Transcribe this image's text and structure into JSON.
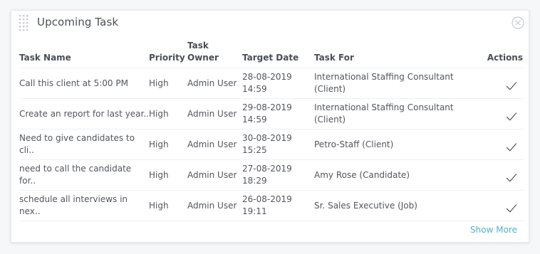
{
  "widget": {
    "title": "Upcoming Task",
    "show_more_label": "Show More",
    "icons": {
      "drag_handle": "drag-handle-icon",
      "close": "close-icon",
      "action": "checkmark-icon"
    },
    "colors": {
      "accent_link": "#4fb3cc",
      "text": "#52565d"
    }
  },
  "table": {
    "headers": {
      "task_name": "Task Name",
      "priority": "Priority",
      "task_owner": "Task Owner",
      "target_date": "Target Date",
      "task_for": "Task For",
      "actions": "Actions"
    },
    "rows": [
      {
        "task_name": "Call this client at 5:00 PM",
        "priority": "High",
        "task_owner": "Admin User",
        "target_date": "28-08-2019 14:59",
        "task_for": "International Staffing Consultant (Client)"
      },
      {
        "task_name": "Create an report for last year..",
        "priority": "High",
        "task_owner": "Admin User",
        "target_date": "29-08-2019 14:59",
        "task_for": "International Staffing Consultant (Client)"
      },
      {
        "task_name": "Need to give candidates to cli..",
        "priority": "High",
        "task_owner": "Admin User",
        "target_date": "30-08-2019 15:25",
        "task_for": "Petro-Staff (Client)"
      },
      {
        "task_name": "need to call the candidate for..",
        "priority": "High",
        "task_owner": "Admin User",
        "target_date": "27-08-2019 18:29",
        "task_for": "Amy Rose (Candidate)"
      },
      {
        "task_name": "schedule all interviews in nex..",
        "priority": "High",
        "task_owner": "Admin User",
        "target_date": "26-08-2019 19:11",
        "task_for": "Sr. Sales Executive (Job)"
      }
    ]
  }
}
